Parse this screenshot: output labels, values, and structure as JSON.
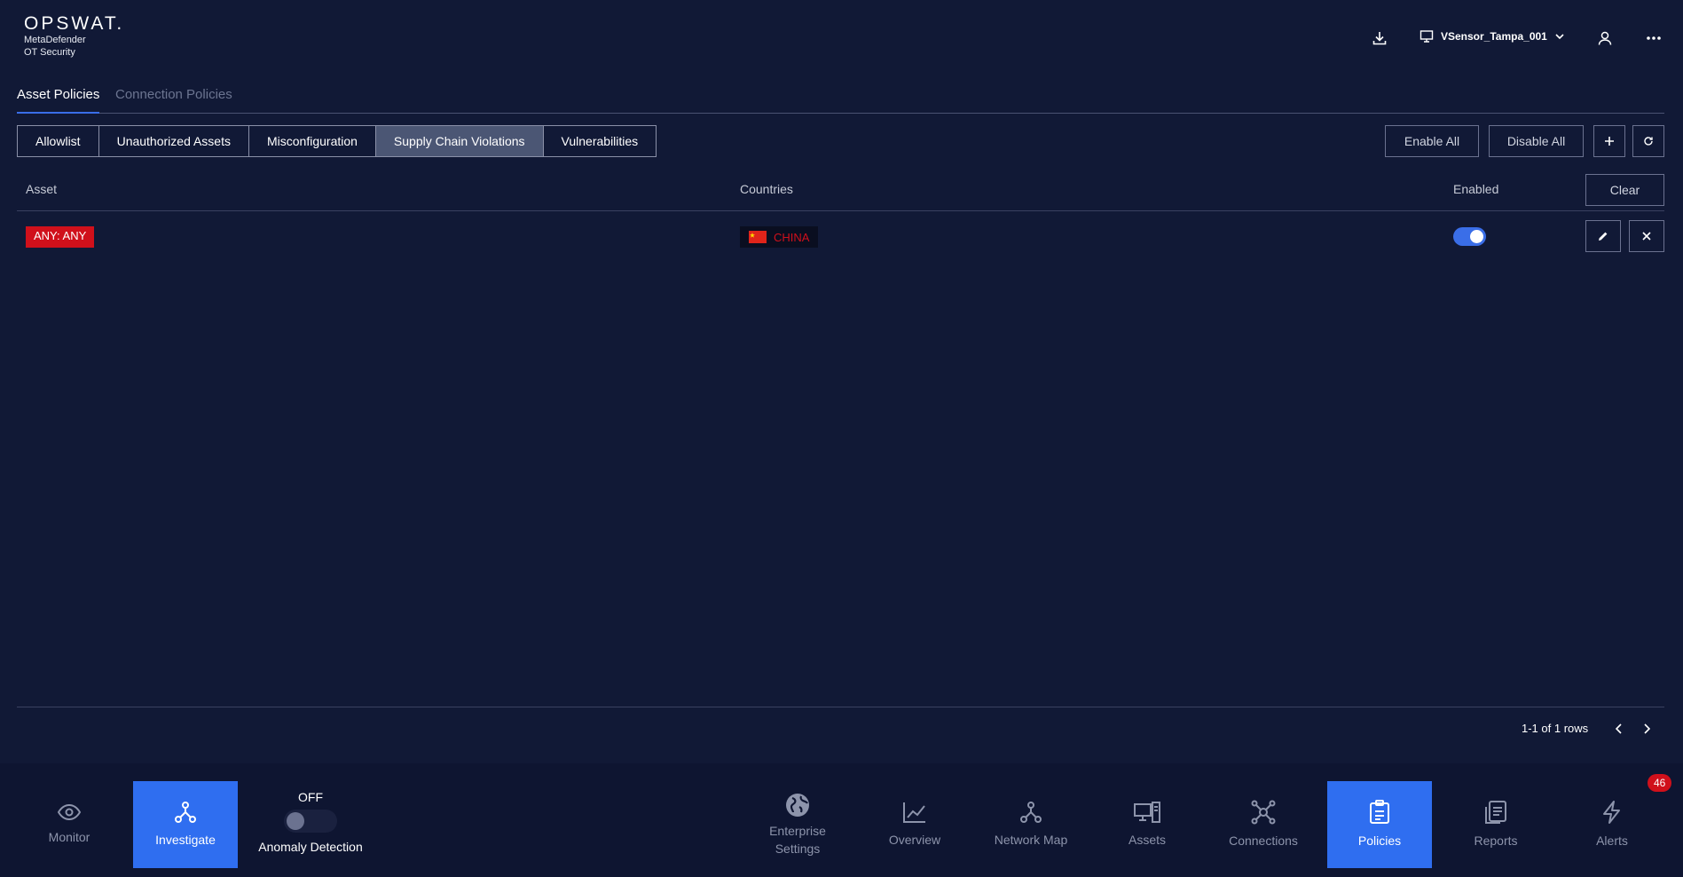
{
  "header": {
    "logo_word": "OPSWAT.",
    "logo_line1": "MetaDefender",
    "logo_line2": "OT Security",
    "sensor_name": "VSensor_Tampa_001"
  },
  "tabs": [
    {
      "label": "Asset Policies",
      "active": true
    },
    {
      "label": "Connection Policies",
      "active": false
    }
  ],
  "subtabs": [
    {
      "label": "Allowlist"
    },
    {
      "label": "Unauthorized Assets"
    },
    {
      "label": "Misconfiguration"
    },
    {
      "label": "Supply Chain Violations",
      "active": true
    },
    {
      "label": "Vulnerabilities"
    }
  ],
  "actions": {
    "enable_all": "Enable All",
    "disable_all": "Disable All",
    "clear": "Clear"
  },
  "table": {
    "columns": [
      "Asset",
      "Countries",
      "Enabled"
    ],
    "rows": [
      {
        "asset": "ANY: ANY",
        "country": "CHINA",
        "enabled": true
      }
    ]
  },
  "pagination": {
    "text": "1-1 of 1 rows"
  },
  "bottom_nav": {
    "monitor": "Monitor",
    "investigate": "Investigate",
    "anomaly_state": "OFF",
    "anomaly_label": "Anomaly Detection",
    "enterprise_line1": "Enterprise",
    "enterprise_line2": "Settings",
    "overview": "Overview",
    "network_map": "Network Map",
    "assets": "Assets",
    "connections": "Connections",
    "policies": "Policies",
    "reports": "Reports",
    "alerts": "Alerts",
    "alerts_count": "46"
  },
  "colors": {
    "background": "#111936",
    "accent": "#2f6ef0",
    "danger": "#d0101b"
  }
}
